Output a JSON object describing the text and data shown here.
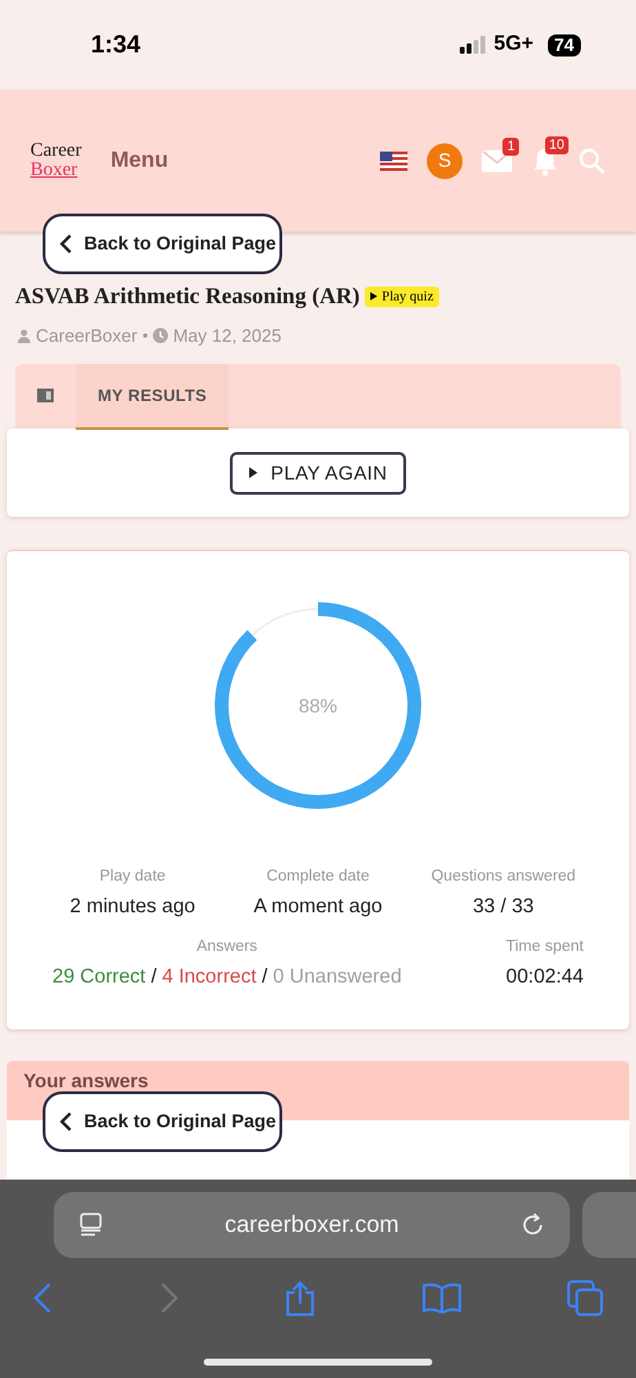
{
  "status_bar": {
    "time": "1:34",
    "network": "5G+",
    "battery": "74"
  },
  "header": {
    "logo_top": "Career",
    "logo_bottom": "Boxer",
    "menu": "Menu",
    "avatar": "S",
    "mail_badge": "1",
    "bell_badge": "10"
  },
  "back_buttons": [
    {
      "label": "Back to Original Page"
    },
    {
      "label": "Back to Original Page"
    }
  ],
  "quiz": {
    "title": "ASVAB Arithmetic Reasoning (AR)",
    "tag": "Play quiz",
    "author": "CareerBoxer",
    "date": "May 12, 2025"
  },
  "tabs": [
    {
      "kind": "icon",
      "selected": false
    },
    {
      "kind": "text",
      "label": "MY RESULTS",
      "selected": true
    }
  ],
  "play_again": "PLAY AGAIN",
  "result": {
    "level": 0.88,
    "percent": "88%",
    "stats": [
      {
        "label": "Play date",
        "value": "2 minutes ago"
      },
      {
        "label": "Complete date",
        "value": "A moment ago"
      },
      {
        "label": "Questions answered",
        "value": "33 / 33"
      }
    ],
    "answers_label": "Answers",
    "answers": [
      {
        "kind": "correct",
        "text": "29 Correct"
      },
      {
        "kind": "separator",
        "text": "/"
      },
      {
        "kind": "incorrect",
        "text": "4 Incorrect"
      },
      {
        "kind": "separator",
        "text": "/"
      },
      {
        "kind": "unanswered",
        "text": "0 Unanswered"
      }
    ],
    "time_label": "Time spent",
    "time_value": "00:02:44"
  },
  "your_answers": {
    "title": "Your answers"
  },
  "browser": {
    "url": "careerboxer.com"
  }
}
